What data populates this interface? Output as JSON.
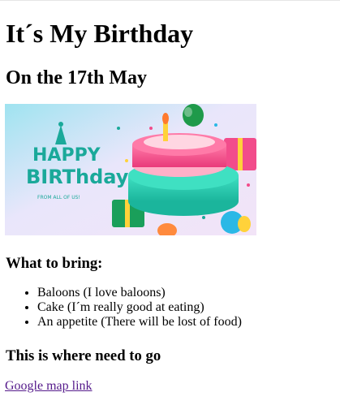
{
  "page": {
    "title": "It´s My Birthday",
    "date_heading": "On the 17th May",
    "banner": {
      "alt": "Happy Birthday",
      "line1": "HAPPY",
      "line2": "BIRThday",
      "tagline": "FROM ALL OF US!"
    },
    "bring_heading": "What to bring:",
    "bring_items": [
      "Baloons (I love baloons)",
      "Cake (I´m really good at eating)",
      "An appetite (There will be lost of food)"
    ],
    "location_heading": "This is where need to go",
    "map_link_text": "Google map link"
  },
  "colors": {
    "link_visited": "#551a8b",
    "banner_text_teal": "#1aa99a",
    "cake_pink": "#f0508a",
    "cake_teal": "#2ccfb3"
  }
}
